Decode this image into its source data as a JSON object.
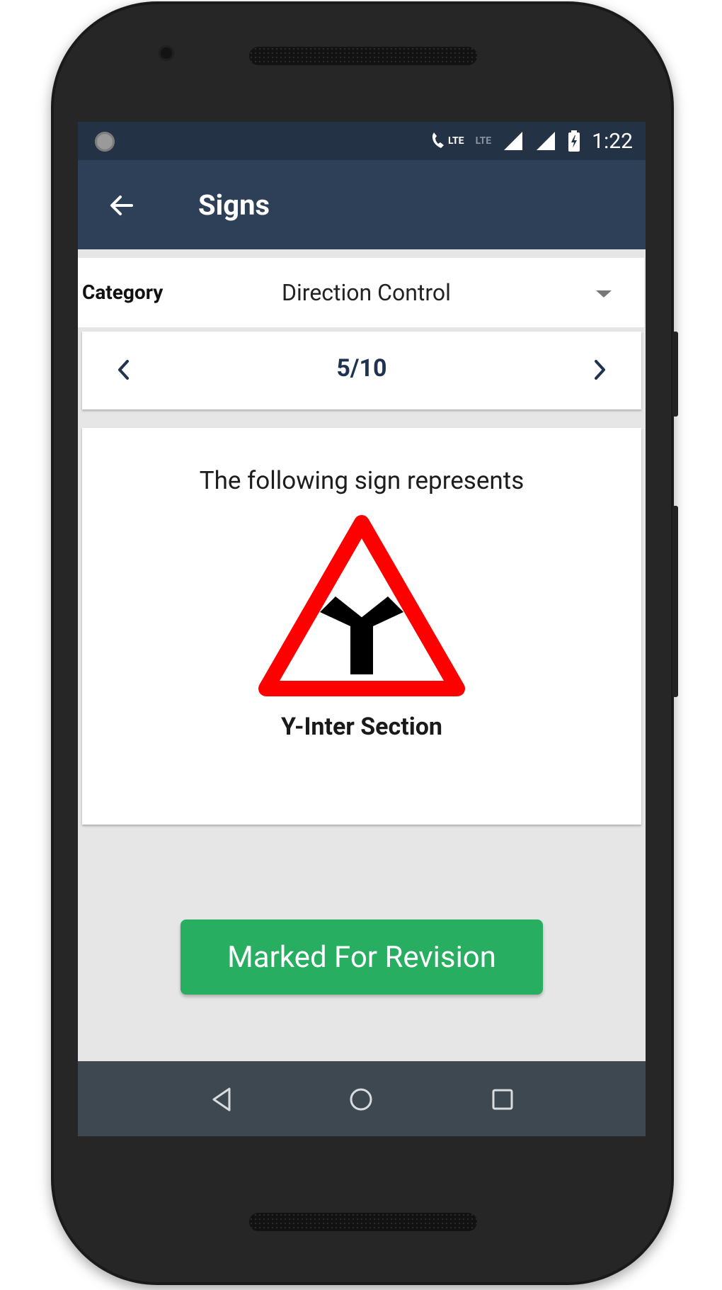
{
  "statusbar": {
    "time": "1:22",
    "network_1": "LTE",
    "network_2": "LTE",
    "icons": [
      "notification-dot-icon",
      "volte-call-icon",
      "lte-icon",
      "signal-icon",
      "signal-icon",
      "battery-charging-icon"
    ]
  },
  "appbar": {
    "title": "Signs",
    "back_icon": "arrow-left-icon"
  },
  "category": {
    "label": "Category",
    "selected": "Direction Control",
    "dropdown_icon": "caret-down-icon"
  },
  "pager": {
    "counter": "5/10",
    "current": 5,
    "total": 10,
    "prev_icon": "chevron-left-icon",
    "next_icon": "chevron-right-icon"
  },
  "question": {
    "prompt": "The following sign represents",
    "sign_icon": "y-intersection-warning-sign",
    "answer": "Y-Inter Section"
  },
  "actions": {
    "revision_label": "Marked For Revision"
  },
  "system_nav": {
    "icons": [
      "back-triangle-icon",
      "home-circle-icon",
      "recents-square-icon"
    ]
  },
  "colors": {
    "statusbar": "#233245",
    "appbar": "#2e4058",
    "accent_green": "#27ae60",
    "counter_text": "#1f3250",
    "sign_red": "#ff0000",
    "navbar": "#3e4851",
    "background": "#e6e6e6"
  }
}
